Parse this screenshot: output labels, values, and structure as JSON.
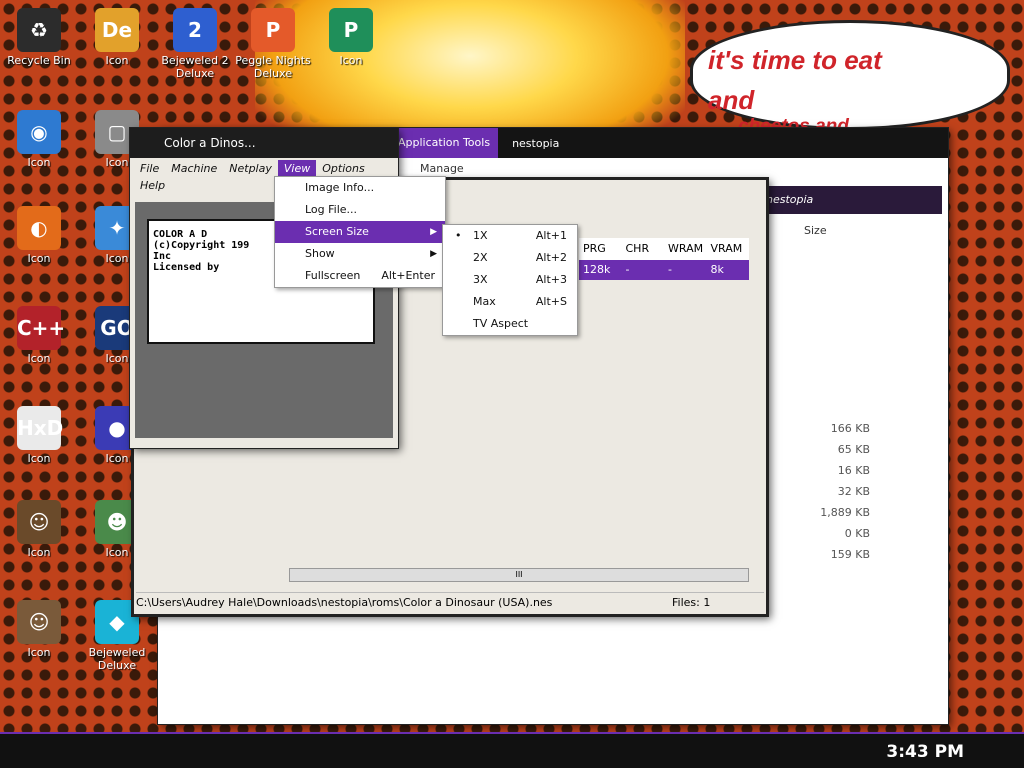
{
  "desktop": {
    "icons": [
      {
        "label": "Recycle Bin",
        "glyph": "♻",
        "color": "#2c2c2c"
      },
      {
        "label": "Icon",
        "glyph": "De",
        "color": "#e2a12b"
      },
      {
        "label": "Bejeweled 2 Deluxe",
        "glyph": "2",
        "color": "#2e5fd0"
      },
      {
        "label": "Peggle Nights Deluxe",
        "glyph": "P",
        "color": "#e45a2a"
      },
      {
        "label": "Icon",
        "glyph": "P",
        "color": "#1f8f5a"
      },
      {
        "label": "Icon",
        "glyph": "◉",
        "color": "#2e7ad1"
      },
      {
        "label": "Icon",
        "glyph": "▢",
        "color": "#8a8a8a"
      },
      {
        "label": "Icon",
        "glyph": "◐",
        "color": "#e36b1a"
      },
      {
        "label": "Icon",
        "glyph": "✦",
        "color": "#3a8ad8"
      },
      {
        "label": "Icon",
        "glyph": "C++",
        "color": "#b3222a"
      },
      {
        "label": "Icon",
        "glyph": "GO",
        "color": "#1a3a7a"
      },
      {
        "label": "Icon",
        "glyph": "HxD",
        "color": "#eaeaea"
      },
      {
        "label": "Icon",
        "glyph": "●",
        "color": "#3b3bb5"
      },
      {
        "label": "Icon",
        "glyph": "☺",
        "color": "#6a4a2a"
      },
      {
        "label": "Icon",
        "glyph": "☻",
        "color": "#4a8a4a"
      },
      {
        "label": "Icon",
        "glyph": "☺",
        "color": "#7a5a3a"
      },
      {
        "label": "Bejeweled Deluxe",
        "glyph": "◆",
        "color": "#1ab3d6"
      }
    ]
  },
  "bubble": {
    "line1": "it's time to eat",
    "line2": "and",
    "line3": "cheetos and"
  },
  "explorer": {
    "apptools_label": "Application Tools",
    "title": "nestopia",
    "manage_label": "Manage",
    "search_text": "nestopia",
    "size_header": "Size",
    "sizes": [
      "166 KB",
      "65 KB",
      "16 KB",
      "32 KB",
      "1,889 KB",
      "0 KB",
      "159 KB"
    ]
  },
  "nestopia": {
    "title": "Color a Dinos...",
    "menus": [
      "File",
      "Machine",
      "Netplay",
      "View",
      "Options",
      "Help"
    ],
    "screen_lines": [
      "COLOR A D",
      "(c)Copyright 199",
      "Inc",
      "Licensed by"
    ]
  },
  "launcher": {
    "columns": [
      "PRG",
      "CHR",
      "WRAM",
      "VRAM"
    ],
    "row": [
      "128k",
      "-",
      "-",
      "8k"
    ],
    "scroll_label": "III",
    "status_path": "C:\\Users\\Audrey Hale\\Downloads\\nestopia\\roms\\Color a Dinosaur (USA).nes",
    "files_label": "Files: 1"
  },
  "view_menu": {
    "items": [
      {
        "label": "Image Info...",
        "accel": ""
      },
      {
        "label": "Log File...",
        "accel": ""
      },
      {
        "label": "Screen Size",
        "accel": ""
      },
      {
        "label": "Show",
        "accel": ""
      },
      {
        "label": "Fullscreen",
        "accel": "Alt+Enter"
      }
    ]
  },
  "size_menu": {
    "items": [
      {
        "label": "1X",
        "accel": "Alt+1"
      },
      {
        "label": "2X",
        "accel": "Alt+2"
      },
      {
        "label": "3X",
        "accel": "Alt+3"
      },
      {
        "label": "Max",
        "accel": "Alt+S"
      },
      {
        "label": "TV Aspect",
        "accel": ""
      }
    ]
  },
  "taskbar": {
    "time": "3:43 PM",
    "accent": "#6b2eb0"
  }
}
